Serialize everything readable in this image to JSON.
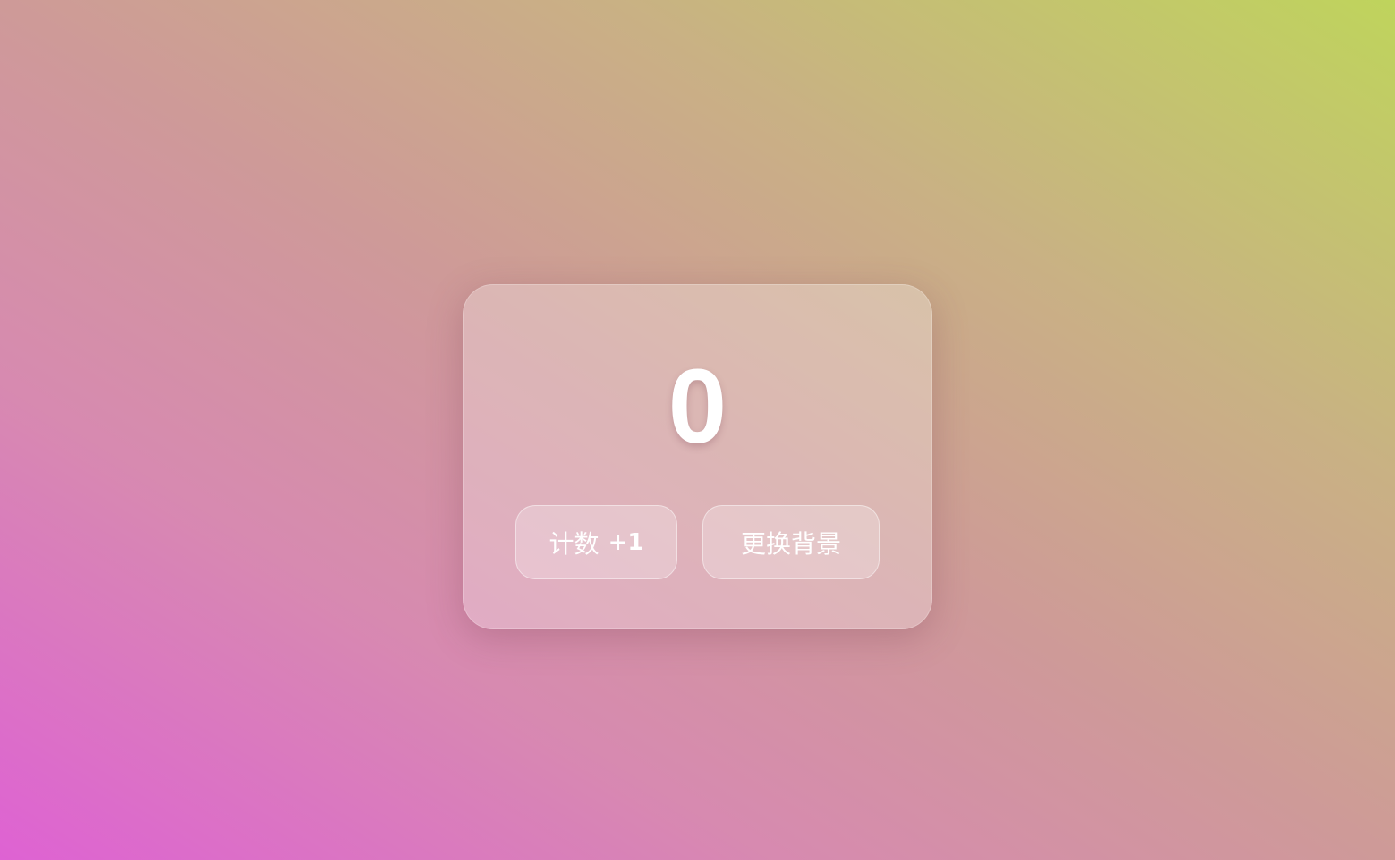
{
  "counter": {
    "value": "0"
  },
  "buttons": {
    "increment_label": "计数",
    "increment_suffix": "+1",
    "change_background_label": "更换背景"
  },
  "colors": {
    "gradient_bottom_left": "#de62d3",
    "gradient_top_right": "#bfd45c",
    "text": "#ffffff"
  }
}
